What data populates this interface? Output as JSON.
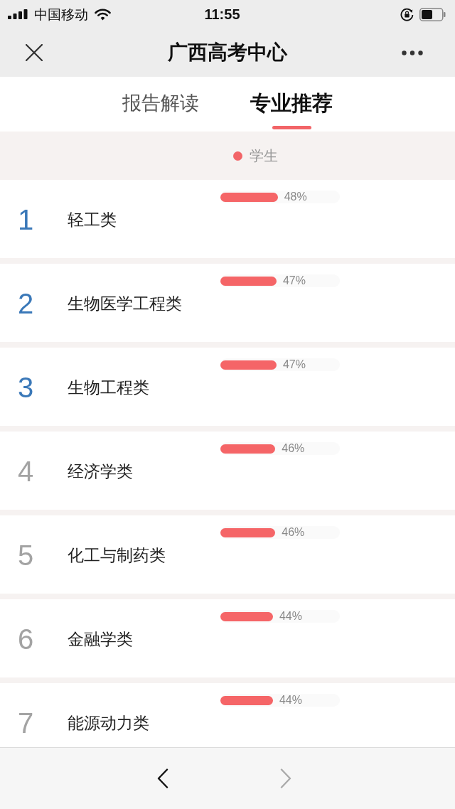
{
  "status_bar": {
    "carrier": "中国移动",
    "time": "11:55"
  },
  "nav_bar": {
    "title": "广西高考中心"
  },
  "tabs": [
    {
      "label": "报告解读",
      "selected": false
    },
    {
      "label": "专业推荐",
      "selected": true
    }
  ],
  "legend": {
    "label": "学生"
  },
  "rows": [
    {
      "rank": "1",
      "name": "轻工类",
      "level": 0.48,
      "reading": "48%",
      "highlighted": true
    },
    {
      "rank": "2",
      "name": "生物医学工程类",
      "level": 0.47,
      "reading": "47%",
      "highlighted": true
    },
    {
      "rank": "3",
      "name": "生物工程类",
      "level": 0.47,
      "reading": "47%",
      "highlighted": true
    },
    {
      "rank": "4",
      "name": "经济学类",
      "level": 0.46,
      "reading": "46%",
      "highlighted": false
    },
    {
      "rank": "5",
      "name": "化工与制药类",
      "level": 0.46,
      "reading": "46%",
      "highlighted": false
    },
    {
      "rank": "6",
      "name": "金融学类",
      "level": 0.44,
      "reading": "44%",
      "highlighted": false
    },
    {
      "rank": "7",
      "name": "能源动力类",
      "level": 0.44,
      "reading": "44%",
      "highlighted": false
    }
  ],
  "toolbar": {
    "buttons": [
      {
        "kind": "back",
        "disabled": false
      },
      {
        "kind": "forward",
        "disabled": true
      }
    ]
  }
}
